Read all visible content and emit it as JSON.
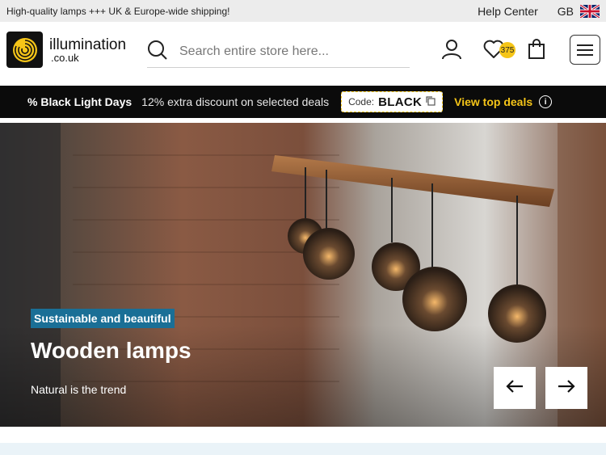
{
  "topbar": {
    "shipping_text": "High-quality lamps +++ UK & Europe-wide shipping!",
    "help_center": "Help Center",
    "country_code": "GB",
    "flag_icon": "uk-flag-icon"
  },
  "header": {
    "logo_line1": "illumination",
    "logo_line2": ".co.uk",
    "search_placeholder": "Search entire store here...",
    "wishlist_count": "375",
    "icons": [
      "search-icon",
      "account-icon",
      "heart-icon",
      "bag-icon",
      "menu-icon"
    ]
  },
  "promo": {
    "title": "% Black Light Days",
    "description": "12% extra discount on selected deals",
    "code_label": "Code:",
    "code_value": "BLACK",
    "deals_label": "View top deals"
  },
  "hero": {
    "tag": "Sustainable and beautiful",
    "headline": "Wooden lamps",
    "subline": "Natural is the trend"
  },
  "colors": {
    "accent_yellow": "#f5c518",
    "tag_blue": "#1a6f96",
    "promo_bg": "#0b0b0b"
  }
}
